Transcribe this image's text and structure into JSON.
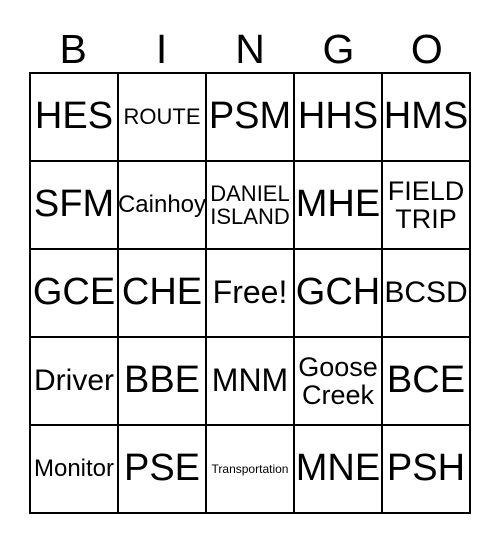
{
  "card": {
    "headers": [
      "B",
      "I",
      "N",
      "G",
      "O"
    ],
    "rows": [
      [
        {
          "text": "HES",
          "size": "fs-xl"
        },
        {
          "text": "ROUTE",
          "size": "fs-xs"
        },
        {
          "text": "PSM",
          "size": "fs-xl"
        },
        {
          "text": "HHS",
          "size": "fs-xl"
        },
        {
          "text": "HMS",
          "size": "fs-xl"
        }
      ],
      [
        {
          "text": "SFM",
          "size": "fs-xl"
        },
        {
          "text": "Cainhoy",
          "size": "fs-sm"
        },
        {
          "text": "DANIEL\nISLAND",
          "size": "fs-xs"
        },
        {
          "text": "MHE",
          "size": "fs-xl"
        },
        {
          "text": "FIELD\nTRIP",
          "size": "fs-mdm"
        }
      ],
      [
        {
          "text": "GCE",
          "size": "fs-xl"
        },
        {
          "text": "CHE",
          "size": "fs-xl"
        },
        {
          "text": "Free!",
          "size": "fs-lg"
        },
        {
          "text": "GCH",
          "size": "fs-xl"
        },
        {
          "text": "BCSD",
          "size": "fs-md"
        }
      ],
      [
        {
          "text": "Driver",
          "size": "fs-md"
        },
        {
          "text": "BBE",
          "size": "fs-xl"
        },
        {
          "text": "MNM",
          "size": "fs-lg"
        },
        {
          "text": "Goose\nCreek",
          "size": "fs-mdm"
        },
        {
          "text": "BCE",
          "size": "fs-xl"
        }
      ],
      [
        {
          "text": "Monitor",
          "size": "fs-sm"
        },
        {
          "text": "PSE",
          "size": "fs-xl"
        },
        {
          "text": "Transportation",
          "size": "fs-xxs"
        },
        {
          "text": "MNE",
          "size": "fs-xl"
        },
        {
          "text": "PSH",
          "size": "fs-xl"
        }
      ]
    ]
  }
}
